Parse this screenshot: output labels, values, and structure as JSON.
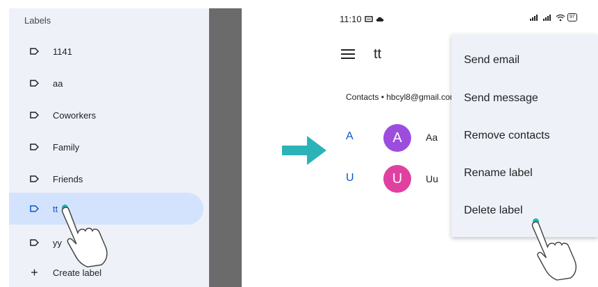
{
  "left_panel": {
    "heading": "Labels",
    "items": [
      {
        "label": "1141"
      },
      {
        "label": "aa"
      },
      {
        "label": "Coworkers"
      },
      {
        "label": "Family"
      },
      {
        "label": "Friends"
      },
      {
        "label": "tt",
        "selected": true
      },
      {
        "label": "yy"
      }
    ],
    "create_label": "Create label"
  },
  "phone": {
    "status_time": "11:10",
    "battery": "97",
    "title": "tt",
    "account": "Contacts • hbcyl8@gmail.com",
    "sections": [
      {
        "letter": "A",
        "initial": "A",
        "name": "Aa",
        "avatar_color": "#9c4dde"
      },
      {
        "letter": "U",
        "initial": "U",
        "name": "Uu",
        "avatar_color": "#e040a0"
      }
    ]
  },
  "popup_menu": {
    "items": [
      "Send email",
      "Send message",
      "Remove contacts",
      "Rename label",
      "Delete label"
    ]
  },
  "colors": {
    "accent_blue": "#0b57d0",
    "selected_bg": "#d3e3fd",
    "arrow_teal": "#2bb3b8"
  }
}
